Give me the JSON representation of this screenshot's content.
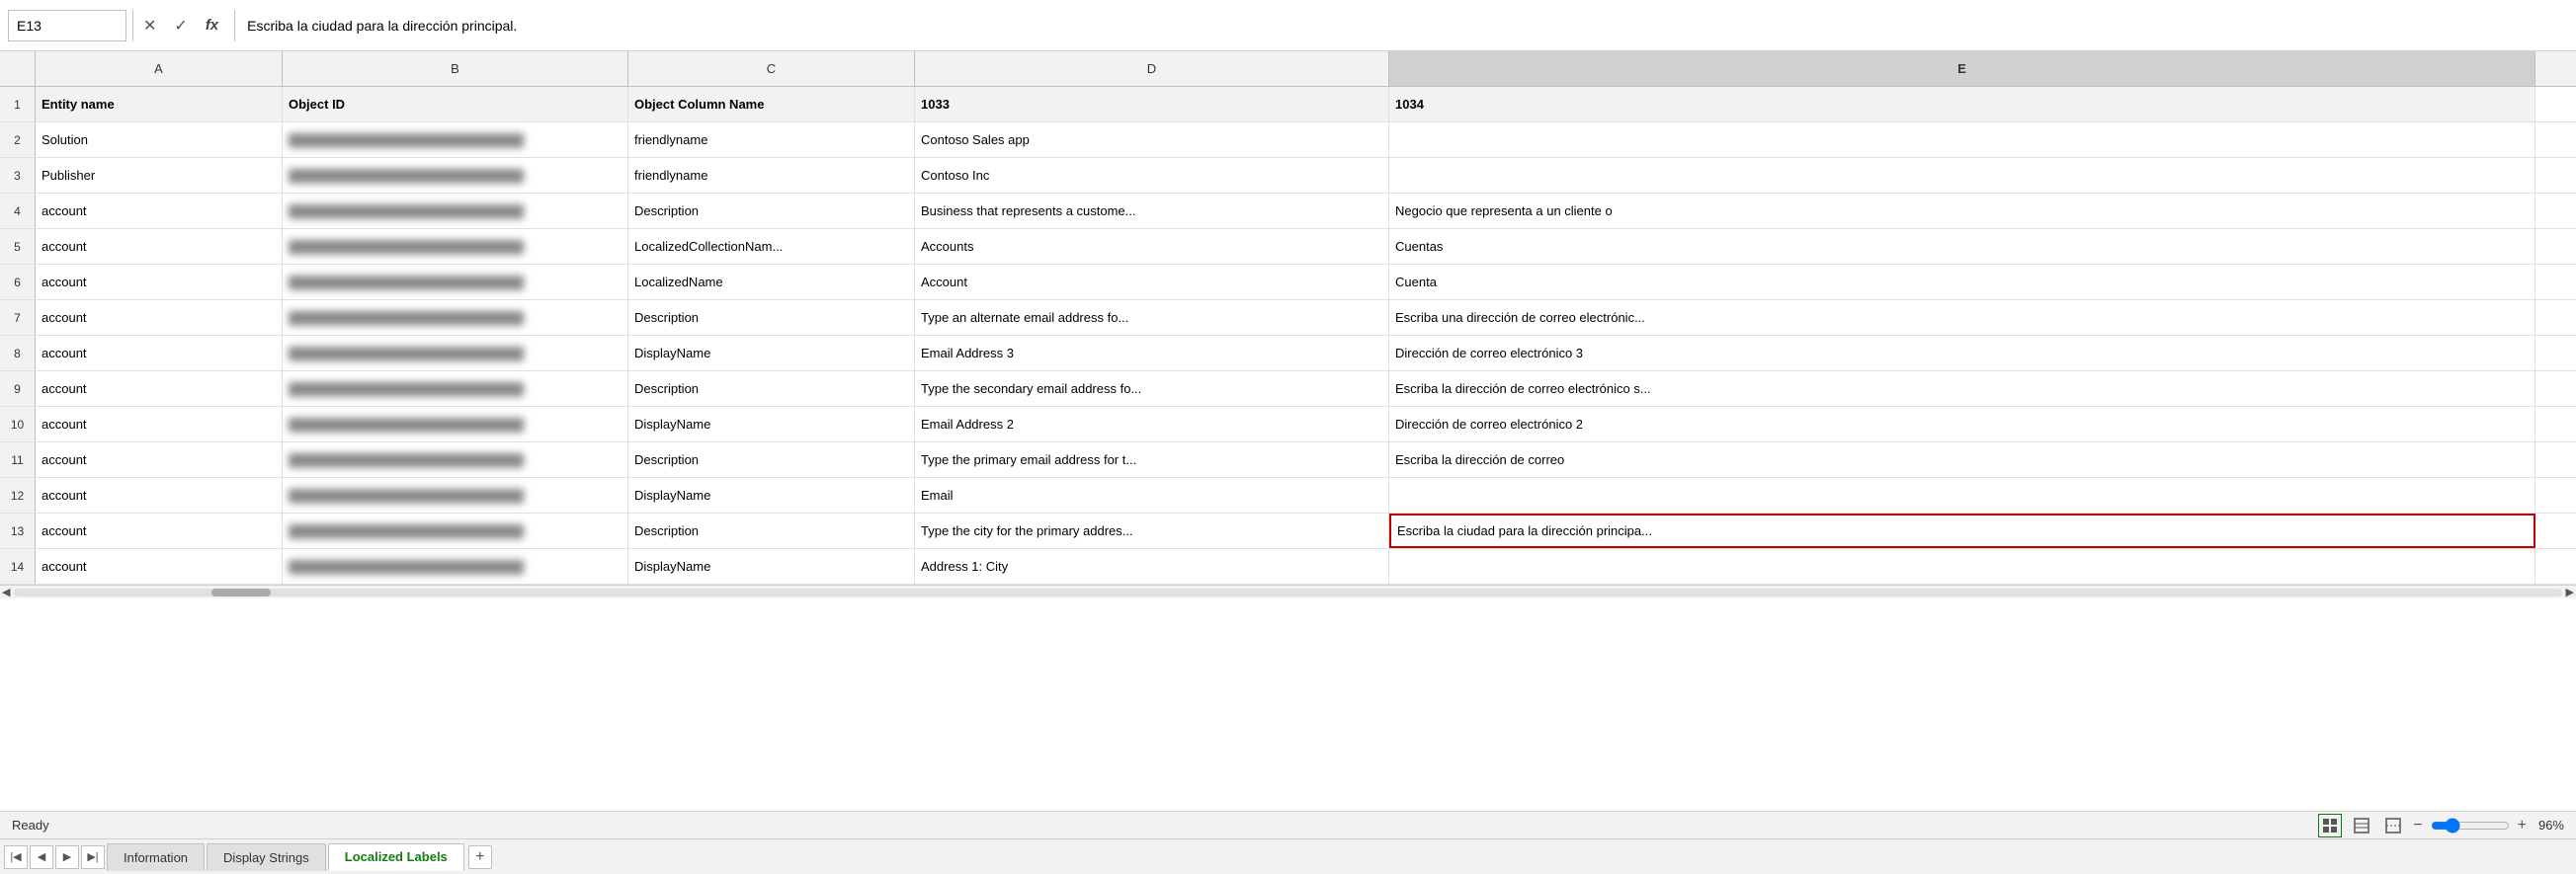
{
  "formula_bar": {
    "cell_ref": "E13",
    "formula_text": "Escriba la ciudad para la dirección principal.",
    "x_label": "✕",
    "check_label": "✓",
    "fx_label": "fx"
  },
  "columns": [
    {
      "id": "row_num",
      "label": "",
      "class": "row-header-corner"
    },
    {
      "id": "A",
      "label": "A",
      "class": "col-a"
    },
    {
      "id": "B",
      "label": "B",
      "class": "col-b"
    },
    {
      "id": "C",
      "label": "C",
      "class": "col-c"
    },
    {
      "id": "D",
      "label": "D",
      "class": "col-d"
    },
    {
      "id": "E",
      "label": "E",
      "class": "col-e"
    }
  ],
  "rows": [
    {
      "row_num": "1",
      "a": "Entity name",
      "b": "Object ID",
      "c": "Object Column Name",
      "d": "1033",
      "e": "1034",
      "a_bold": true,
      "b_bold": true,
      "c_bold": true
    },
    {
      "row_num": "2",
      "a": "Solution",
      "b": "",
      "c": "friendlyname",
      "d": "Contoso Sales app",
      "e": ""
    },
    {
      "row_num": "3",
      "a": "Publisher",
      "b": "",
      "c": "friendlyname",
      "d": "Contoso Inc",
      "e": ""
    },
    {
      "row_num": "4",
      "a": "account",
      "b": "",
      "c": "Description",
      "d": "Business that represents a custome...",
      "e": "Negocio que representa a un cliente o"
    },
    {
      "row_num": "5",
      "a": "account",
      "b": "",
      "c": "LocalizedCollectionNam...",
      "d": "Accounts",
      "e": "Cuentas"
    },
    {
      "row_num": "6",
      "a": "account",
      "b": "",
      "c": "LocalizedName",
      "d": "Account",
      "e": "Cuenta"
    },
    {
      "row_num": "7",
      "a": "account",
      "b": "",
      "c": "Description",
      "d": "Type an alternate email address fo...",
      "e": "Escriba una dirección de correo electrónic..."
    },
    {
      "row_num": "8",
      "a": "account",
      "b": "",
      "c": "DisplayName",
      "d": "Email Address 3",
      "e": "Dirección de correo electrónico 3"
    },
    {
      "row_num": "9",
      "a": "account",
      "b": "",
      "c": "Description",
      "d": "Type the secondary email address fo...",
      "e": "Escriba la dirección de correo electrónico s..."
    },
    {
      "row_num": "10",
      "a": "account",
      "b": "",
      "c": "DisplayName",
      "d": "Email Address 2",
      "e": "Dirección de correo electrónico 2"
    },
    {
      "row_num": "11",
      "a": "account",
      "b": "",
      "c": "Description",
      "d": "Type the primary email address for t...",
      "e": "Escriba la dirección de correo"
    },
    {
      "row_num": "12",
      "a": "account",
      "b": "",
      "c": "DisplayName",
      "d": "Email",
      "e": ""
    },
    {
      "row_num": "13",
      "a": "account",
      "b": "",
      "c": "Description",
      "d": "Type the city for the primary addres...",
      "e": "Escriba la ciudad para la dirección principa..."
    },
    {
      "row_num": "14",
      "a": "account",
      "b": "",
      "c": "DisplayName",
      "d": "Address 1: City",
      "e": ""
    }
  ],
  "tabs": [
    {
      "label": "Information",
      "active": false
    },
    {
      "label": "Display Strings",
      "active": false
    },
    {
      "label": "Localized Labels",
      "active": true
    }
  ],
  "status": {
    "ready_label": "Ready",
    "zoom_label": "96%",
    "add_sheet_label": "+"
  }
}
